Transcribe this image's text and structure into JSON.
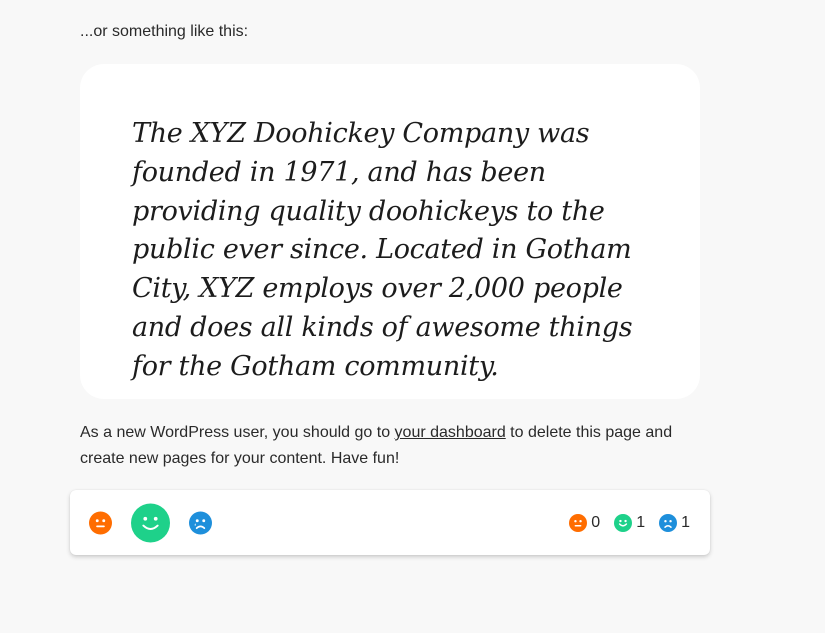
{
  "intro": "...or something like this:",
  "quote": "The XYZ Doohickey Company was founded in 1971, and has been providing quality doohickeys to the public ever since. Located in Gotham City, XYZ employs over 2,000 people and does all kinds of awesome things for the Gotham community.",
  "body": {
    "before_link": "As a new WordPress user, you should go to ",
    "link_text": "your dashboard",
    "after_link": " to delete this page and create new pages for your content. Have fun!"
  },
  "reactions": {
    "buttons": [
      {
        "name": "neutral",
        "icon": "neutral-face-icon",
        "color": "#ff6d00",
        "selected": false
      },
      {
        "name": "happy",
        "icon": "smile-face-icon",
        "color": "#1ed18a",
        "selected": true
      },
      {
        "name": "sad",
        "icon": "sad-face-icon",
        "color": "#1e8fdb",
        "selected": false
      }
    ],
    "counts": [
      {
        "icon": "neutral-face-icon",
        "color": "#ff6d00",
        "value": "0"
      },
      {
        "icon": "smile-face-icon",
        "color": "#1ed18a",
        "value": "1"
      },
      {
        "icon": "sad-face-icon",
        "color": "#1e8fdb",
        "value": "1"
      }
    ]
  }
}
